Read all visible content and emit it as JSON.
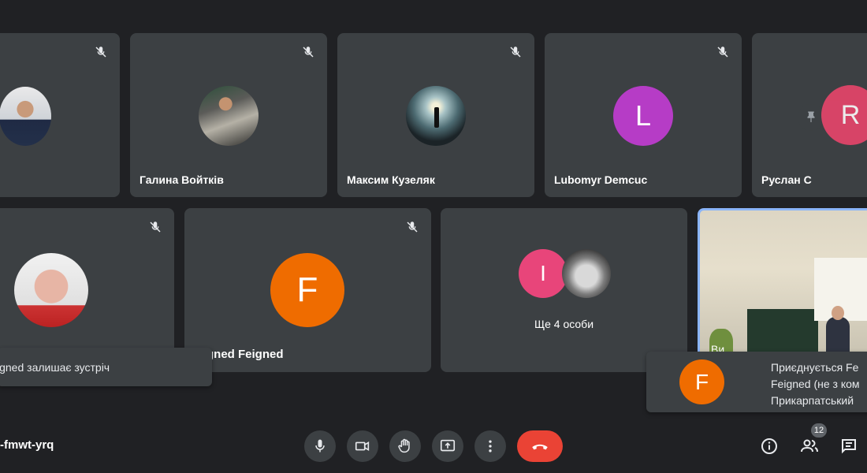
{
  "participants": [
    {
      "name": "",
      "avatar": "photo"
    },
    {
      "name": "Галина Войтків",
      "avatar": "photo"
    },
    {
      "name": "Максим Кузеляк",
      "avatar": "photo"
    },
    {
      "name": "Lubomyr Demcuc",
      "avatar_letter": "L",
      "avatar_color": "#b63cc6"
    },
    {
      "name": "Руслан С",
      "avatar_letter": "R",
      "avatar_color": "#e8456b"
    },
    {
      "name": "",
      "avatar": "photo"
    },
    {
      "name": "gned Feigned",
      "avatar_letter": "F",
      "avatar_color": "#ef6c00"
    }
  ],
  "group_tile": {
    "label": "Ще 4 особи",
    "avatar_letter": "I",
    "avatar_color": "#e8457a"
  },
  "self_tile": {
    "name_partial": "Ви"
  },
  "toasts": {
    "leaving": "igned залишає зустріч",
    "joining": {
      "avatar_letter": "F",
      "avatar_color": "#ef6c00",
      "lines": [
        "Приєднується Fe",
        "Feigned (не з ком",
        "Прикарпатський"
      ]
    }
  },
  "meeting_code": "-fmwt-yrq",
  "participants_count": "12",
  "icons": {
    "mic_off": "mic-off-icon",
    "mic": "mic-icon",
    "camera": "camera-icon",
    "raise_hand": "hand-icon",
    "present": "present-icon",
    "more": "more-icon",
    "end_call": "end-call-icon",
    "info": "info-icon",
    "people": "people-icon",
    "chat": "chat-icon",
    "pin": "pin-icon"
  },
  "colors": {
    "background": "#202124",
    "tile": "#3c4043",
    "end_call": "#ea4335",
    "self_border": "#8ab4f8"
  }
}
